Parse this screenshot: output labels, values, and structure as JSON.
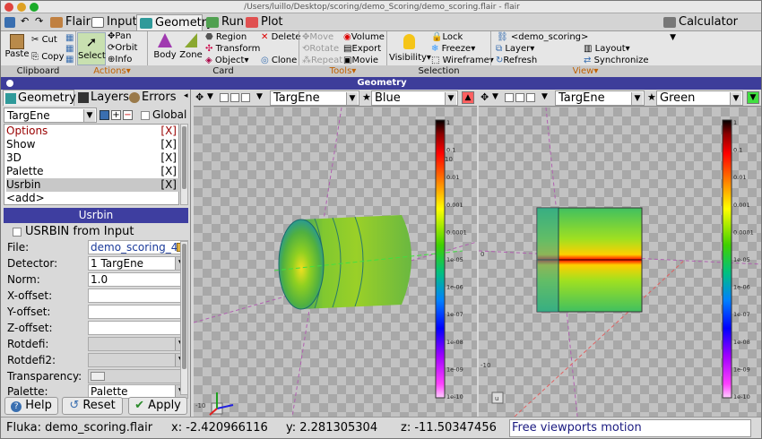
{
  "window": {
    "title": "/Users/luillo/Desktop/scoring/demo_Scoring/demo_scoring.flair - flair"
  },
  "tabs": [
    {
      "label": "Flair",
      "icon": "flair-icon"
    },
    {
      "label": "Input",
      "icon": "input-icon"
    },
    {
      "label": "Geometry",
      "icon": "geometry-icon",
      "selected": true
    },
    {
      "label": "Run",
      "icon": "run-icon"
    },
    {
      "label": "Plot",
      "icon": "plot-icon"
    }
  ],
  "calculator": "Calculator",
  "ribbon": {
    "clipboard": {
      "paste": "Paste",
      "cut": "Cut",
      "copy": "Copy",
      "group": "Clipboard"
    },
    "actions": {
      "select": "Select",
      "pan": "Pan",
      "orbit": "Orbit",
      "info": "Info",
      "group": "Actions"
    },
    "card": {
      "body": "Body",
      "zone": "Zone",
      "region": "Region",
      "transform": "Transform",
      "object": "Object",
      "delete": "Delete",
      "clone": "Clone",
      "group": "Card"
    },
    "tools": {
      "move": "Move",
      "rotate": "Rotate",
      "repeat": "Repeat",
      "volume": "Volume",
      "export": "Export",
      "movie": "Movie",
      "group": "Tools"
    },
    "selection": {
      "visibility": "Visibility",
      "lock": "Lock",
      "freeze": "Freeze",
      "wireframe": "Wireframe",
      "group": "Selection"
    },
    "view": {
      "project": "<demo_scoring>",
      "layer": "Layer",
      "layout": "Layout",
      "refresh": "Refresh",
      "synchronize": "Synchronize",
      "group": "View"
    }
  },
  "geometry_title": "Geometry",
  "left_panel": {
    "tabs": [
      "Geometry",
      "Layers",
      "Errors"
    ],
    "layer_name": "TargEne",
    "global_label": "Global",
    "layers": [
      {
        "name": "Options",
        "mark": "[X]",
        "color": "#990000"
      },
      {
        "name": "Show",
        "mark": "[X]"
      },
      {
        "name": "3D",
        "mark": "[X]"
      },
      {
        "name": "Palette",
        "mark": "[X]"
      },
      {
        "name": "Usrbin",
        "mark": "[X]",
        "selected": true
      },
      {
        "name": "<add>",
        "mark": ""
      }
    ],
    "usrbin": {
      "header": "Usrbin",
      "from_input": "USRBIN from Input",
      "fields": [
        {
          "label": "File:",
          "value": "demo_scoring_4"
        },
        {
          "label": "Detector:",
          "value": "1 TargEne"
        },
        {
          "label": "Norm:",
          "value": "1.0"
        },
        {
          "label": "X-offset:",
          "value": ""
        },
        {
          "label": "Y-offset:",
          "value": ""
        },
        {
          "label": "Z-offset:",
          "value": ""
        },
        {
          "label": "Rotdefi:",
          "value": ""
        },
        {
          "label": "Rotdefi2:",
          "value": ""
        },
        {
          "label": "Transparency:",
          "value": ""
        },
        {
          "label": "Palette:",
          "value": "Palette"
        }
      ]
    },
    "buttons": {
      "help": "Help",
      "reset": "Reset",
      "apply": "Apply"
    }
  },
  "viewports": [
    {
      "layer": "TargEne",
      "color": "Blue",
      "color_swatch": "#ff6060"
    },
    {
      "layer": "TargEne",
      "color": "Green",
      "color_swatch": "#40e040"
    }
  ],
  "colorbar_ticks": [
    "1",
    "0.1",
    "0.01",
    "0.001",
    "0.0001",
    "1e-05",
    "1e-06",
    "1e-07",
    "1e-08",
    "1e-09",
    "1e-10"
  ],
  "status": {
    "file": "Fluka: demo_scoring.flair",
    "x": "x: -2.420966116",
    "y": "y: 2.281305304",
    "z": "z: -11.50347456",
    "mode": "Free viewports motion"
  }
}
